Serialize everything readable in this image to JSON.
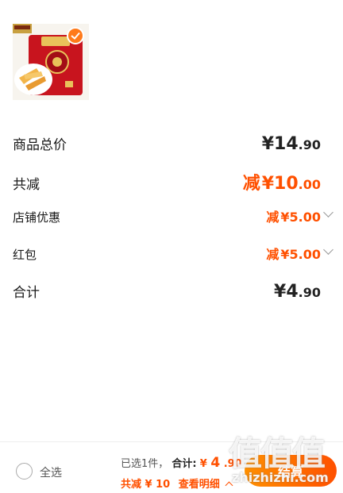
{
  "product": {
    "image_icon": "snack-package-icon",
    "selected_icon": "checkmark-icon"
  },
  "price_rows": [
    {
      "label": "商品总价",
      "prefix": "",
      "yuan": "¥",
      "int": "14",
      "dec": ".90",
      "color": "#222222"
    },
    {
      "label": "共减",
      "prefix": "减",
      "yuan": "¥",
      "int": "10",
      "dec": ".00",
      "color": "#ff5000"
    },
    {
      "label": "店铺优惠",
      "prefix": "减",
      "yuan": "¥",
      "int": "5",
      "dec": ".00",
      "color": "#ff5000"
    },
    {
      "label": "红包",
      "prefix": "减",
      "yuan": "¥",
      "int": "5",
      "dec": ".00",
      "color": "#ff5000"
    },
    {
      "label": "合计",
      "prefix": "",
      "yuan": "¥",
      "int": "4",
      "dec": ".90",
      "color": "#222222"
    }
  ],
  "bottom_bar": {
    "select_all": "全选",
    "selected_count": "已选1件，",
    "total_label": "合计:",
    "total_yuan": "¥",
    "total_int": "4",
    "total_dec": ".90",
    "discount_text": "共减 ¥ 10",
    "detail_link": "查看明细",
    "checkout_label": "结算"
  },
  "watermark": {
    "big": "值值值",
    "small": "zhizhizhi.com"
  },
  "colors": {
    "accent": "#ff5000",
    "accent_light": "#ff9000"
  }
}
